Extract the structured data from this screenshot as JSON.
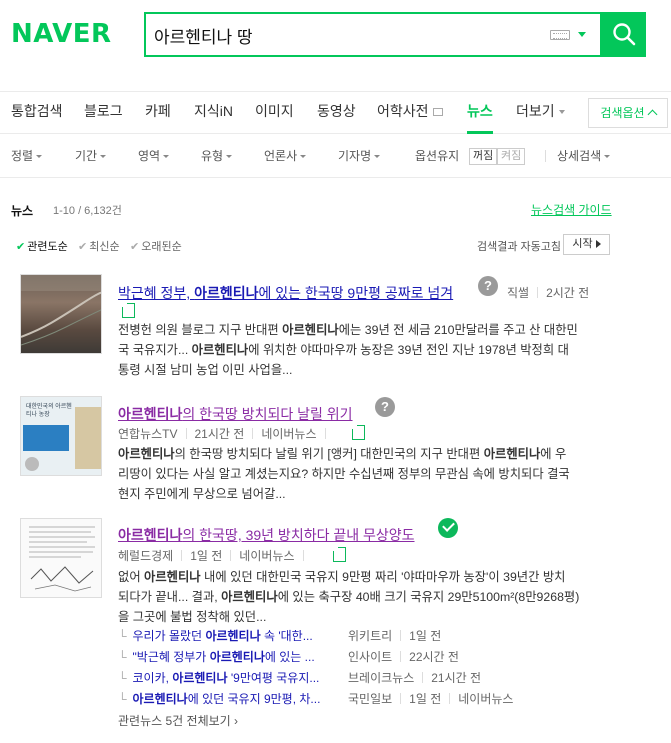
{
  "logo": "NAVER",
  "search": {
    "query": "아르헨티나 땅"
  },
  "tabs": [
    {
      "label": "통합검색"
    },
    {
      "label": "블로그"
    },
    {
      "label": "카페"
    },
    {
      "label": "지식iN"
    },
    {
      "label": "이미지"
    },
    {
      "label": "동영상"
    },
    {
      "label": "어학사전"
    },
    {
      "label": "뉴스"
    },
    {
      "label": "더보기"
    }
  ],
  "search_options": "검색옵션",
  "filters": [
    "정렬",
    "기간",
    "영역",
    "유형",
    "언론사",
    "기자명",
    "옵션유지",
    "상세검색"
  ],
  "option_keep": {
    "on": "꺼짐",
    "off": "켜짐"
  },
  "news": {
    "section": "뉴스",
    "count": "1-10 / 6,132건",
    "guide": "뉴스검색 가이드",
    "sort": [
      "관련도순",
      "최신순",
      "오래된순"
    ],
    "autoplay": "검색결과 자동고침",
    "start": "시작",
    "items": [
      {
        "title_pre": "박근혜 정부, ",
        "title_hl": "아르헨티나",
        "title_post": "에 있는 한국땅 9만평 공짜로 넘겨",
        "source": "직썰",
        "time": "2시간 전",
        "snippet1_pre": "전병헌 의원 블로그 지구 반대편 ",
        "snippet1_hl": "아르헨티나",
        "snippet1_post": "에는 39년 전 세금 210만달러를 주고 산 대한민",
        "snippet2_pre": "국 국유지가... ",
        "snippet2_hl": "아르헨티나",
        "snippet2_post": "에 위치한 야따마우까 농장은 39년 전인 지난 1978년 박정희 대",
        "snippet3": "통령 시절 남미 농업 이민 사업을..."
      },
      {
        "title_hl": "아르헨티나",
        "title_post": "의 한국땅 방치되다 날릴 위기",
        "source": "연합뉴스TV",
        "time": "21시간 전",
        "naver": "네이버뉴스",
        "thumb_text": "대한민국의 아르헨티나 농장",
        "snippet1_hl": "아르헨티나",
        "snippet1_pre": "의 한국땅 방치되다 날릴 위기 [앵커] 대한민국의 지구 반대편 ",
        "snippet1_hl2": "아르헨티나",
        "snippet1_post": "에 우",
        "snippet2": "리땅이 있다는 사실 알고 계셨는지요? 하지만 수십년째 정부의 무관심 속에 방치되다 결국",
        "snippet3": "현지 주민에게 무상으로 넘어갈..."
      },
      {
        "title_hl": "아르헨티나",
        "title_post": "의 한국땅, 39년 방치하다 끝내 무상양도",
        "source": "헤럴드경제",
        "time": "1일 전",
        "naver": "네이버뉴스",
        "snippet1_pre": "없어 ",
        "snippet1_hl": "아르헨티나",
        "snippet1_post": " 내에 있던 대한민국 국유지 9만평 짜리 '야따마우까 농장'이 39년간 방치",
        "snippet2_pre": "되다가 끝내... 결과, ",
        "snippet2_hl": "아르헨티나",
        "snippet2_post": "에 있는 축구장 40배 크기 국유지 29만5100m²(8만9268평)",
        "snippet3": "을 그곳에 불법 정착해 있던...",
        "related": [
          {
            "pre": "우리가 몰랐던 ",
            "hl": "아르헨티나",
            "post": " 속 '대한...",
            "source": "위키트리",
            "time": "1일 전"
          },
          {
            "pre": "\"박근혜 정부가 ",
            "hl": "아르헨티나",
            "post": "에 있는 ...",
            "source": "인사이트",
            "time": "22시간 전"
          },
          {
            "pre": "코이카, ",
            "hl": "아르헨티나",
            "post": " '9만여평 국유지...",
            "source": "브레이크뉴스",
            "time": "21시간 전"
          },
          {
            "pre": "",
            "hl": "아르헨티나",
            "post": "에 있던 국유지 9만평, 차...",
            "source": "국민일보",
            "time": "1일 전",
            "naver": "네이버뉴스"
          }
        ],
        "related_all": "관련뉴스 5건 전체보기"
      }
    ]
  }
}
